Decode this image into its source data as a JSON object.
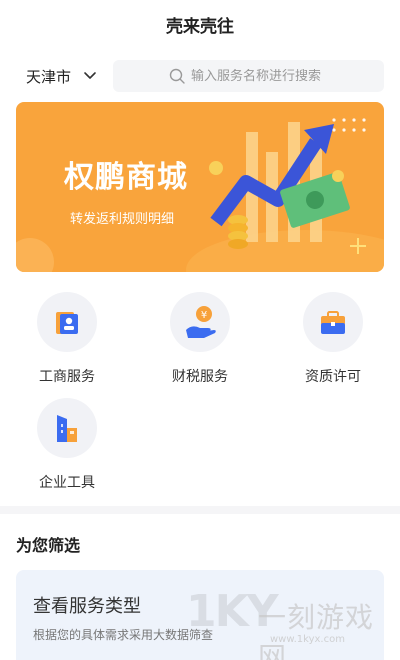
{
  "header": {
    "title": "壳来壳往"
  },
  "location": {
    "city": "天津市"
  },
  "search": {
    "placeholder": "输入服务名称进行搜索"
  },
  "banner": {
    "title": "权鹏商城",
    "subtitle": "转发返利规则明细"
  },
  "services": [
    {
      "label": "工商服务",
      "icon": "id-card-icon"
    },
    {
      "label": "财税服务",
      "icon": "yen-hand-icon"
    },
    {
      "label": "资质许可",
      "icon": "briefcase-icon"
    },
    {
      "label": "企业工具",
      "icon": "building-icon"
    }
  ],
  "filter": {
    "title": "为您筛选",
    "card": {
      "title": "查看服务类型",
      "description": "根据您的具体需求采用大数据筛查"
    }
  },
  "watermark": {
    "logo": "1KY",
    "text": "一刻游戏网",
    "url": "www.1kyx.com"
  },
  "colors": {
    "banner": "#f9a43c",
    "accent_blue": "#3b6cf0",
    "accent_orange": "#f7a13a"
  }
}
